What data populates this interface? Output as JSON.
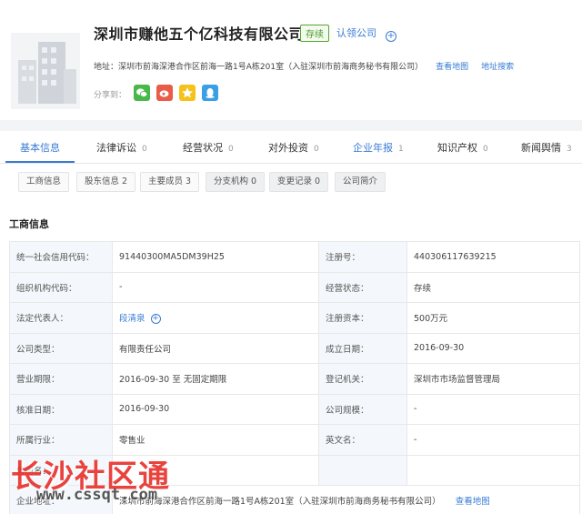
{
  "company": {
    "name": "深圳市赚他五个亿科技有限公司",
    "status": "存续",
    "claim_label": "认领公司"
  },
  "address": {
    "prefix": "地址：",
    "text": "深圳市前海深港合作区前海一路1号A栋201室（入驻深圳市前海商务秘书有限公司）",
    "map_link": "查看地图",
    "search_link": "地址搜索"
  },
  "share": {
    "label": "分享到：",
    "icons": [
      "wechat-icon",
      "weibo-icon",
      "qzone-icon",
      "qq-icon"
    ]
  },
  "tabs": [
    {
      "label": "基本信息",
      "count": ""
    },
    {
      "label": "法律诉讼",
      "count": "0"
    },
    {
      "label": "经营状况",
      "count": "0"
    },
    {
      "label": "对外投资",
      "count": "0"
    },
    {
      "label": "企业年报",
      "count": "1"
    },
    {
      "label": "知识产权",
      "count": "0"
    },
    {
      "label": "新闻舆情",
      "count": "3"
    }
  ],
  "subtabs": [
    {
      "label": "工商信息"
    },
    {
      "label": "股东信息 2"
    },
    {
      "label": "主要成员 3"
    },
    {
      "label": "分支机构 0"
    },
    {
      "label": "变更记录 0"
    },
    {
      "label": "公司简介"
    }
  ],
  "section": {
    "title": "工商信息"
  },
  "rows": [
    {
      "l1": "统一社会信用代码：",
      "v1": "91440300MA5DM39H25",
      "l2": "注册号：",
      "v2": "440306117639215"
    },
    {
      "l1": "组织机构代码：",
      "v1": "-",
      "l2": "经营状态：",
      "v2": "存续"
    },
    {
      "l1": "法定代表人：",
      "v1": "段清泉",
      "l2": "注册资本：",
      "v2": "500万元"
    },
    {
      "l1": "公司类型：",
      "v1": "有限责任公司",
      "l2": "成立日期：",
      "v2": "2016-09-30"
    },
    {
      "l1": "营业期限：",
      "v1": "2016-09-30 至 无固定期限",
      "l2": "登记机关：",
      "v2": "深圳市市场监督管理局"
    },
    {
      "l1": "核准日期：",
      "v1": "2016-09-30",
      "l2": "公司规模：",
      "v2": "-"
    },
    {
      "l1": "所属行业：",
      "v1": "零售业",
      "l2": "英文名：",
      "v2": "-"
    },
    {
      "l1": "曾用名：",
      "v1": "",
      "l2": "",
      "v2": ""
    }
  ],
  "address_row": {
    "label": "企业地址：",
    "value": "深圳市前海深港合作区前海一路1号A栋201室（入驻深圳市前海商务秘书有限公司）",
    "map_link": "查看地图"
  },
  "watermark": {
    "text": "长沙社区通",
    "url": "www.cssqt.com"
  },
  "colors": {
    "accent": "#3a7bd5",
    "status_green": "#4d9a2a",
    "label_bg": "#f4f7fb",
    "watermark_red": "#e8342e"
  }
}
